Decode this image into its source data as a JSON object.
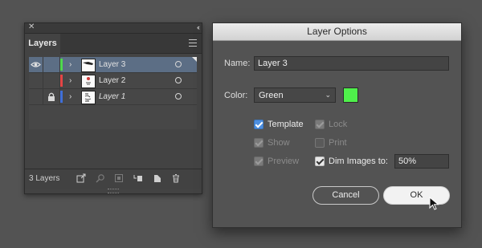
{
  "layers_panel": {
    "tab_label": "Layers",
    "layer_count_label": "3 Layers",
    "layers": [
      {
        "name": "Layer 3",
        "color": "#4fd94f",
        "visible": true,
        "locked": false,
        "selected": true,
        "italic": false
      },
      {
        "name": "Layer 2",
        "color": "#e54545",
        "visible": false,
        "locked": false,
        "selected": false,
        "italic": false
      },
      {
        "name": "Layer 1",
        "color": "#3f6fd8",
        "visible": false,
        "locked": true,
        "selected": false,
        "italic": true
      }
    ],
    "footer_icons": [
      "collect-export-icon",
      "locate-object-icon",
      "make-clipping-mask-icon",
      "new-sublayer-icon",
      "new-layer-icon",
      "delete-icon"
    ]
  },
  "dialog": {
    "title": "Layer Options",
    "name_label": "Name:",
    "name_value": "Layer 3",
    "color_label": "Color:",
    "color_value": "Green",
    "swatch_color": "#4ff04b",
    "options": {
      "template": {
        "label": "Template",
        "checked": true,
        "enabled": true
      },
      "lock": {
        "label": "Lock",
        "checked": true,
        "enabled": false
      },
      "show": {
        "label": "Show",
        "checked": true,
        "enabled": false
      },
      "print": {
        "label": "Print",
        "checked": false,
        "enabled": false
      },
      "preview": {
        "label": "Preview",
        "checked": true,
        "enabled": false
      },
      "dim_images": {
        "label": "Dim Images to:",
        "checked": true,
        "enabled": true
      }
    },
    "dim_value": "50%",
    "cancel_label": "Cancel",
    "ok_label": "OK"
  }
}
